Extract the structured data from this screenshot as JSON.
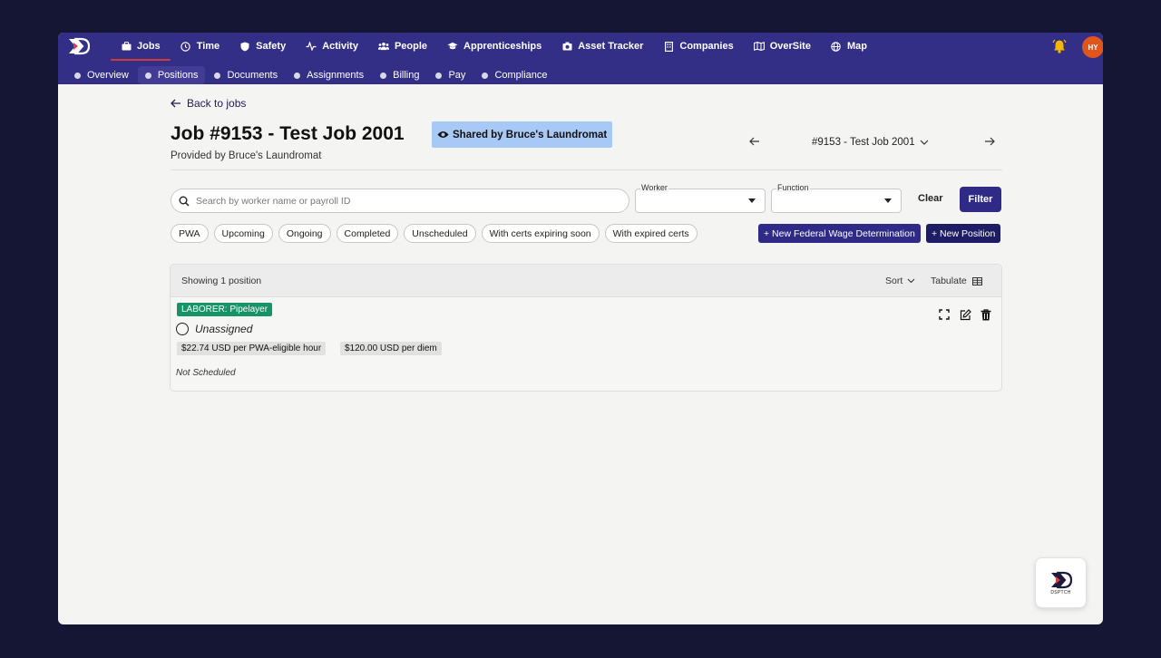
{
  "nav": {
    "items": [
      {
        "label": "Jobs",
        "icon": "briefcase-icon",
        "active": true
      },
      {
        "label": "Time",
        "icon": "clock-icon"
      },
      {
        "label": "Safety",
        "icon": "shield-icon"
      },
      {
        "label": "Activity",
        "icon": "activity-icon"
      },
      {
        "label": "People",
        "icon": "people-icon"
      },
      {
        "label": "Apprenticeships",
        "icon": "graduation-cap-icon"
      },
      {
        "label": "Asset Tracker",
        "icon": "camera-icon"
      },
      {
        "label": "Companies",
        "icon": "building-icon"
      },
      {
        "label": "OverSite",
        "icon": "map-icon"
      },
      {
        "label": "Map",
        "icon": "globe-icon"
      }
    ],
    "avatar_initials": "HY",
    "accent_color": "#332e86",
    "bell_color": "#f5b800"
  },
  "subnav": {
    "items": [
      {
        "label": "Overview"
      },
      {
        "label": "Positions",
        "active": true
      },
      {
        "label": "Documents"
      },
      {
        "label": "Assignments"
      },
      {
        "label": "Billing"
      },
      {
        "label": "Pay"
      },
      {
        "label": "Compliance"
      }
    ]
  },
  "page": {
    "back_label": "Back to jobs",
    "title": "Job #9153 - Test Job 2001",
    "shared_label": "Shared by Bruce's Laundromat",
    "provided_by": "Provided by Bruce's Laundromat",
    "job_selector": "#9153 - Test Job 2001"
  },
  "filters": {
    "search_placeholder": "Search by worker name or payroll ID",
    "worker_label": "Worker",
    "function_label": "Function",
    "clear_label": "Clear",
    "filter_label": "Filter",
    "chips": [
      "PWA",
      "Upcoming",
      "Ongoing",
      "Completed",
      "Unscheduled",
      "With certs expiring soon",
      "With expired certs"
    ],
    "new_fwd_label": "+ New Federal Wage Determination",
    "new_position_label": "+ New Position"
  },
  "positions": {
    "showing": "Showing 1 position",
    "sort_label": "Sort",
    "tabulate_label": "Tabulate",
    "items": [
      {
        "role": "LABORER: Pipelayer",
        "assignee": "Unassigned",
        "rate": "$22.74 USD per PWA-eligible hour",
        "per_diem": "$120.00 USD per diem",
        "schedule": "Not Scheduled"
      }
    ]
  },
  "fab": {
    "caption": "DSPTCH"
  }
}
